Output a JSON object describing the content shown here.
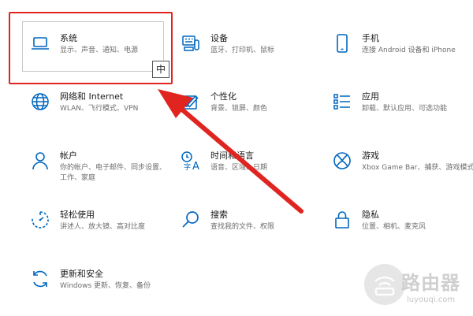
{
  "settings": {
    "tiles": [
      {
        "title": "系统",
        "desc": "显示、声音、通知、电源"
      },
      {
        "title": "设备",
        "desc": "蓝牙、打印机、鼠标"
      },
      {
        "title": "手机",
        "desc": "连接 Android 设备和 iPhone"
      },
      {
        "title": "网络和 Internet",
        "desc": "WLAN、飞行模式、VPN"
      },
      {
        "title": "个性化",
        "desc": "背景、锁屏、颜色"
      },
      {
        "title": "应用",
        "desc": "卸载、默认应用、可选功能"
      },
      {
        "title": "帐户",
        "desc": "你的帐户、电子邮件、同步设置、工作、家庭"
      },
      {
        "title": "时间和语言",
        "desc": "语音、区域、日期"
      },
      {
        "title": "游戏",
        "desc": "Xbox Game Bar、捕获、游戏模式"
      },
      {
        "title": "轻松使用",
        "desc": "讲述人、放大镜、高对比度"
      },
      {
        "title": "搜索",
        "desc": "查找我的文件、权限"
      },
      {
        "title": "隐私",
        "desc": "位置、相机、麦克风"
      },
      {
        "title": "更新和安全",
        "desc": "Windows 更新、恢复、备份"
      }
    ]
  },
  "ime_indicator": "中",
  "watermark": {
    "title": "路由器",
    "subtitle": "luyouqi.com"
  },
  "colors": {
    "accent": "#0067c0",
    "highlight": "#e02521"
  },
  "icons": [
    "laptop-icon",
    "keyboard-icon",
    "phone-icon",
    "globe-icon",
    "paint-icon",
    "apps-icon",
    "person-icon",
    "time-language-icon",
    "xbox-icon",
    "ease-access-icon",
    "search-icon",
    "lock-icon",
    "update-icon"
  ]
}
